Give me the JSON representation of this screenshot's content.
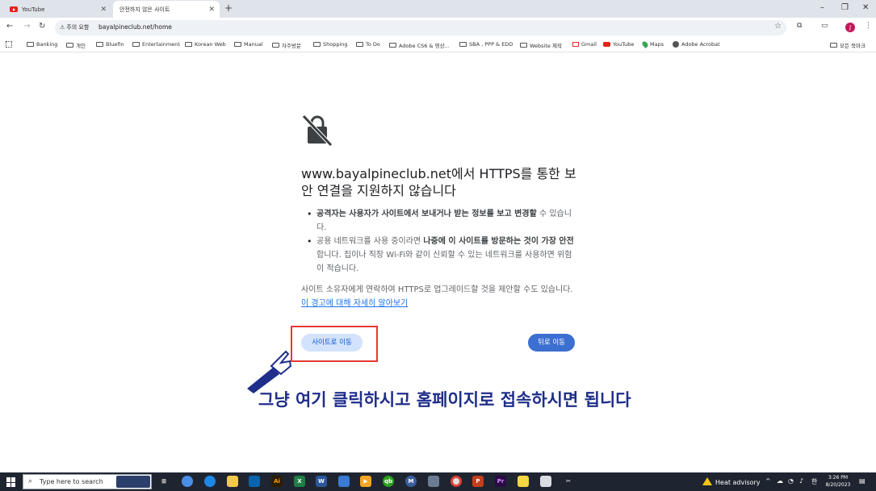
{
  "tabs": [
    {
      "label": "YouTube",
      "active": false
    },
    {
      "label": "안전하지 않은 사이트",
      "active": true
    }
  ],
  "new_tab_symbol": "+",
  "address": {
    "security_chip": "주의 요함",
    "url": "bayalpineclub.net/home"
  },
  "bookmarks": [
    {
      "label": "Banking",
      "icon": "folder-icon"
    },
    {
      "label": "개인",
      "icon": "folder-icon"
    },
    {
      "label": "Bluefin",
      "icon": "folder-icon"
    },
    {
      "label": "Entertainment",
      "icon": "folder-icon"
    },
    {
      "label": "Korean Web",
      "icon": "folder-icon"
    },
    {
      "label": "Manual",
      "icon": "folder-icon"
    },
    {
      "label": "자주방문",
      "icon": "folder-icon"
    },
    {
      "label": "Shopping",
      "icon": "folder-icon"
    },
    {
      "label": "To Do",
      "icon": "folder-icon"
    },
    {
      "label": "Adobe CS6 & 영상...",
      "icon": "folder-icon"
    },
    {
      "label": "SBA , PPP & EDD",
      "icon": "folder-icon"
    },
    {
      "label": "Website 제작",
      "icon": "folder-icon"
    },
    {
      "label": "Gmail",
      "icon": "gmail-icon"
    },
    {
      "label": "YouTube",
      "icon": "youtube-icon"
    },
    {
      "label": "Maps",
      "icon": "maps-icon"
    },
    {
      "label": "Adobe Acrobat",
      "icon": "acrobat-icon"
    }
  ],
  "all_bookmarks_label": "모든 북마크",
  "avatar_letter": "J",
  "warning": {
    "heading": "www.bayalpineclub.net에서 HTTPS를 통한 보안 연결을 지원하지 않습니다",
    "bullet1_bold": "공격자는 사용자가 사이트에서 보내거나 받는 정보를 보고 변경할",
    "bullet1_rest": " 수 있습니다.",
    "bullet2_start": "공용 네트워크를 사용 중이라면 ",
    "bullet2_bold": "나중에 이 사이트를 방문하는 것이 가장 안전",
    "bullet2_rest": "합니다. 집이나 직장 Wi-Fi와 같이 신뢰할 수 있는 네트워크를 사용하면 위험이 적습니다.",
    "paragraph": "사이트 소유자에게 연락하여 HTTPS로 업그레이드할 것을 제안할 수도 있습니다. ",
    "learn_more_link": "이 경고에 대해 자세히 알아보기",
    "go_button": "사이트로 이동",
    "back_button": "뒤로 이동"
  },
  "annotation": {
    "caption": "그냥 여기 클릭하시고 홈페이지로 접속하시면 됩니다",
    "box_color": "#e53935",
    "caption_color": "#1f2e8a"
  },
  "taskbar": {
    "search_placeholder": "Type here to search",
    "weather": "Heat advisory",
    "time": "3:26 PM",
    "date": "8/20/2023"
  },
  "colors": {
    "primary_button": "#3b6fd0",
    "tonal_button": "#d3e3fd",
    "link": "#1a73e8"
  }
}
